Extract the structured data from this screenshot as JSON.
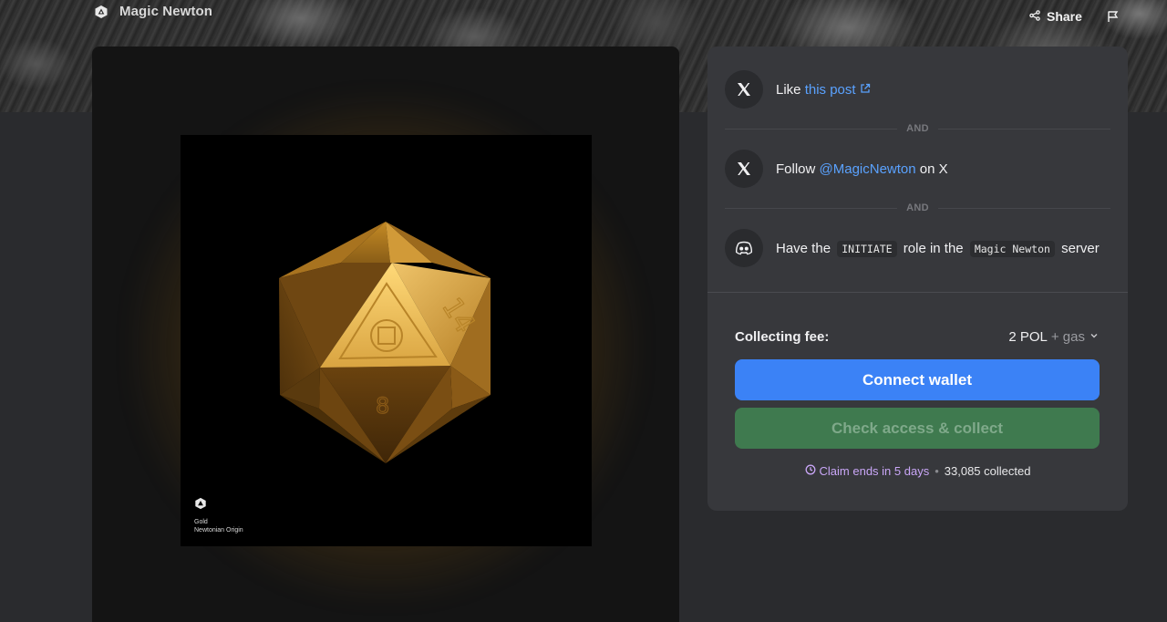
{
  "header": {
    "brand_name": "Magic Newton",
    "share_label": "Share"
  },
  "artwork": {
    "caption_line1": "Gold",
    "caption_line2": "Newtonian Origin",
    "die_numbers": [
      "14",
      "8"
    ],
    "accent_color": "#d9a441"
  },
  "requirements": {
    "items": [
      {
        "icon": "x-logo-icon",
        "prefix": "Like ",
        "link": "this post",
        "link_icon": "external-link-icon",
        "suffix": ""
      },
      {
        "icon": "x-logo-icon",
        "prefix": "Follow ",
        "link": "@MagicNewton",
        "suffix": " on X"
      },
      {
        "icon": "discord-icon",
        "prefix": "Have the ",
        "code1": "INITIATE",
        "middle": " role in the ",
        "code2": "Magic Newton",
        "suffix": " server"
      }
    ],
    "separator_label": "AND"
  },
  "collect": {
    "fee_label": "Collecting fee:",
    "fee_amount": "2 POL",
    "fee_extra": "+ gas",
    "connect_label": "Connect wallet",
    "collect_label": "Check access & collect",
    "claim_ends": "Claim ends in 5 days",
    "separator": "•",
    "collected_count": "33,085 collected"
  },
  "colors": {
    "primary_button": "#3b82f6",
    "collect_button": "#3f7a4f",
    "link": "#5aa2ff",
    "claim_text": "#c9a6f7"
  }
}
